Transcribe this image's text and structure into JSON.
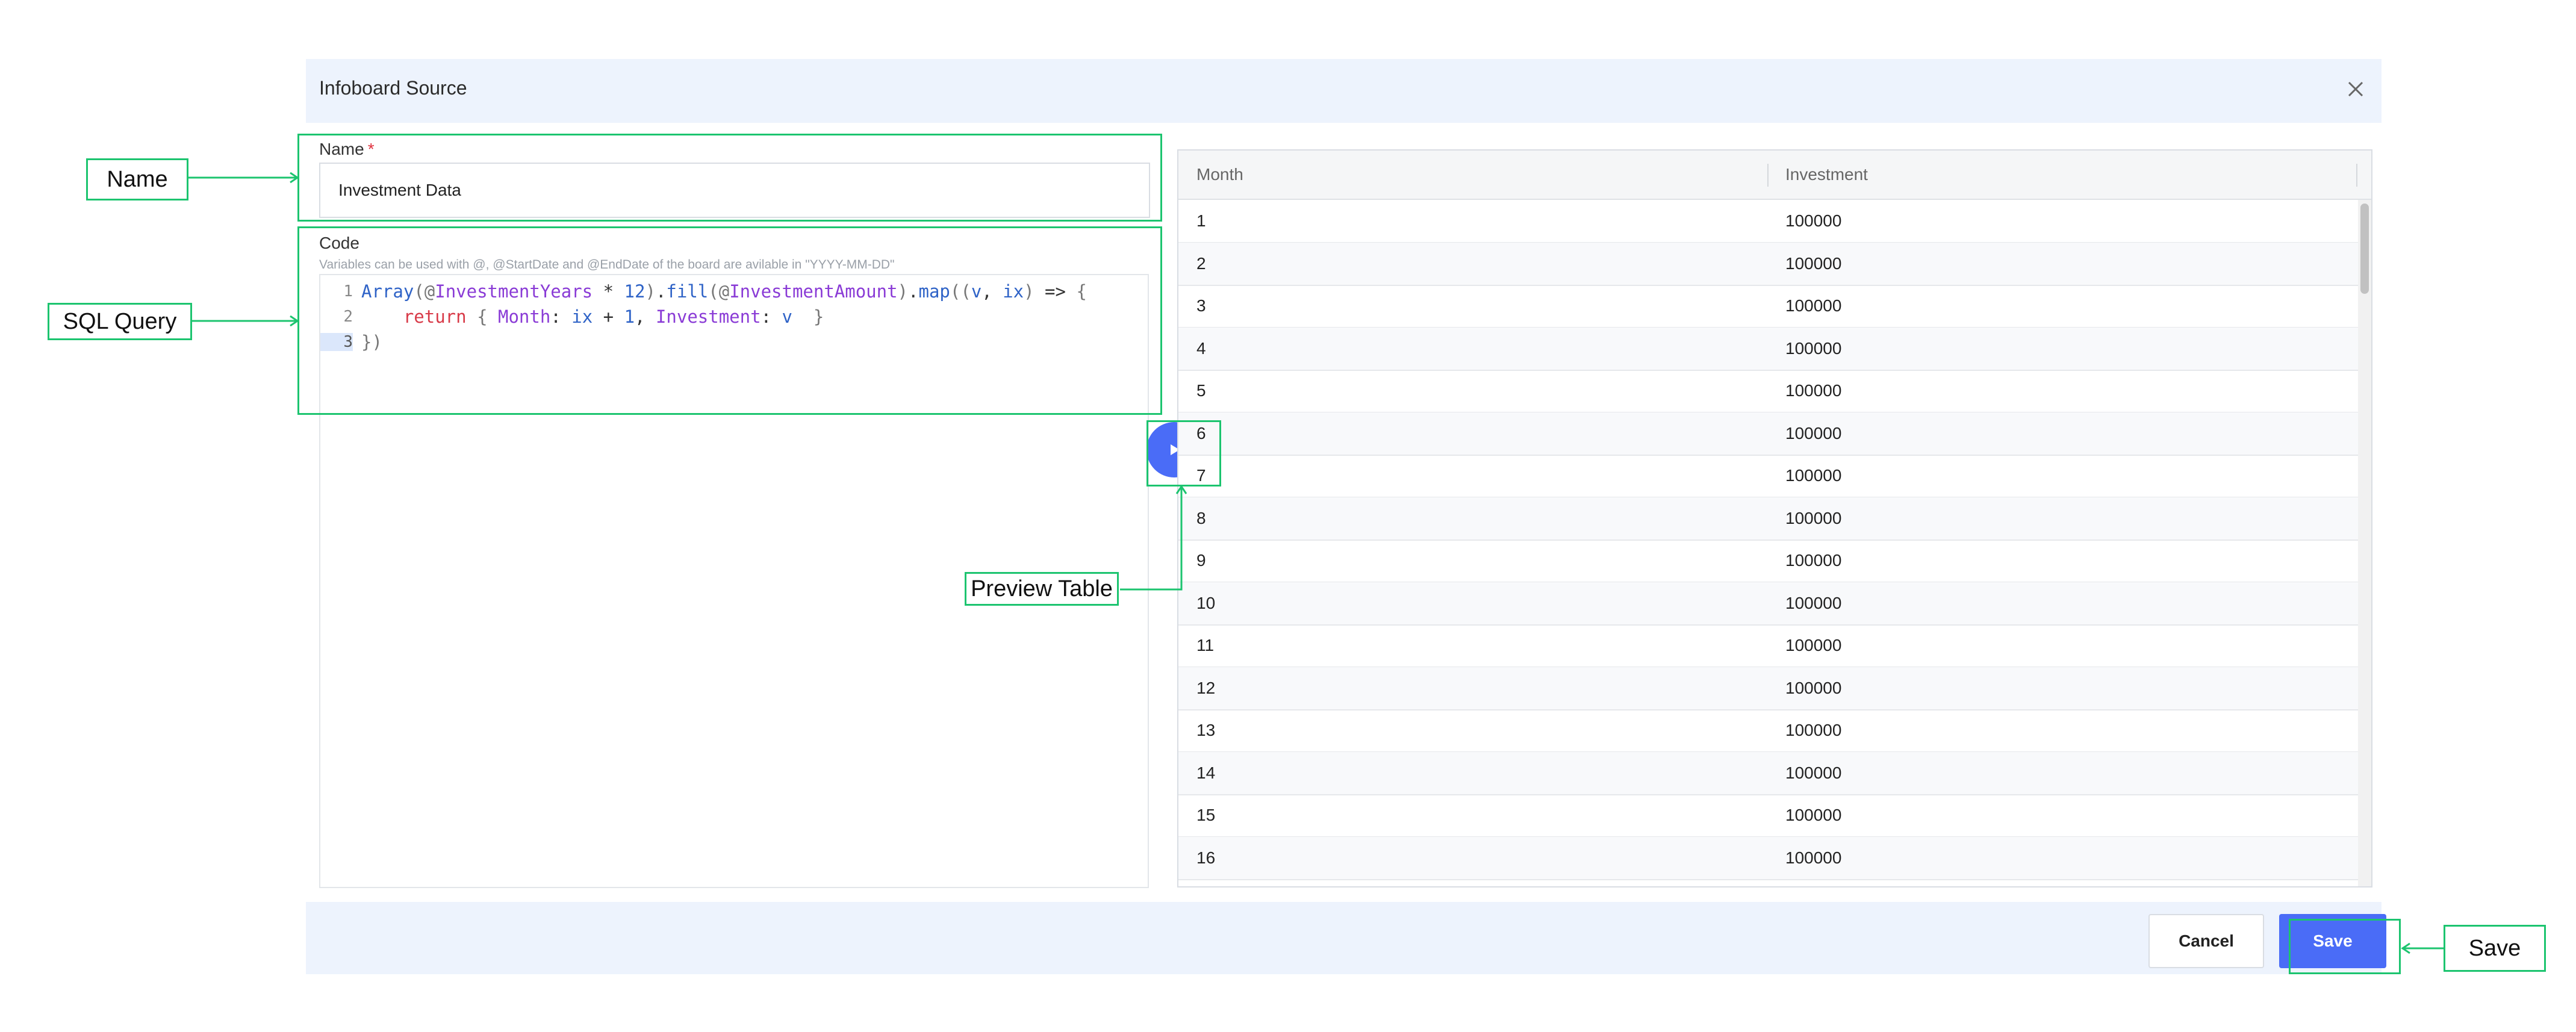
{
  "dialog": {
    "title": "Infoboard Source",
    "close_icon": "close-icon"
  },
  "form": {
    "name_label": "Name",
    "required_marker": "*",
    "name_value": "Investment Data",
    "code_label": "Code",
    "code_hint": "Variables can be used with @, @StartDate and @EndDate of the board are avilable in \"YYYY-MM-DD\"",
    "line_numbers": [
      "1",
      "2",
      "3"
    ],
    "code_lines": [
      "Array(@InvestmentYears * 12).fill(@InvestmentAmount).map((v, ix) => {",
      "    return { Month: ix + 1, Investment: v  }",
      "})"
    ]
  },
  "run_button": {
    "icon": "play-icon"
  },
  "table": {
    "columns": [
      "Month",
      "Investment"
    ],
    "rows": [
      [
        "1",
        "100000"
      ],
      [
        "2",
        "100000"
      ],
      [
        "3",
        "100000"
      ],
      [
        "4",
        "100000"
      ],
      [
        "5",
        "100000"
      ],
      [
        "6",
        "100000"
      ],
      [
        "7",
        "100000"
      ],
      [
        "8",
        "100000"
      ],
      [
        "9",
        "100000"
      ],
      [
        "10",
        "100000"
      ],
      [
        "11",
        "100000"
      ],
      [
        "12",
        "100000"
      ],
      [
        "13",
        "100000"
      ],
      [
        "14",
        "100000"
      ],
      [
        "15",
        "100000"
      ],
      [
        "16",
        "100000"
      ]
    ]
  },
  "footer": {
    "cancel_label": "Cancel",
    "save_label": "Save"
  },
  "annotations": {
    "name": "Name",
    "sql_query": "SQL Query",
    "preview_table": "Preview Table",
    "save": "Save"
  },
  "colors": {
    "accent": "#4a6cf7",
    "annotation": "#1cc46f",
    "header_bg": "#edf3fd",
    "required": "#e0313e"
  }
}
